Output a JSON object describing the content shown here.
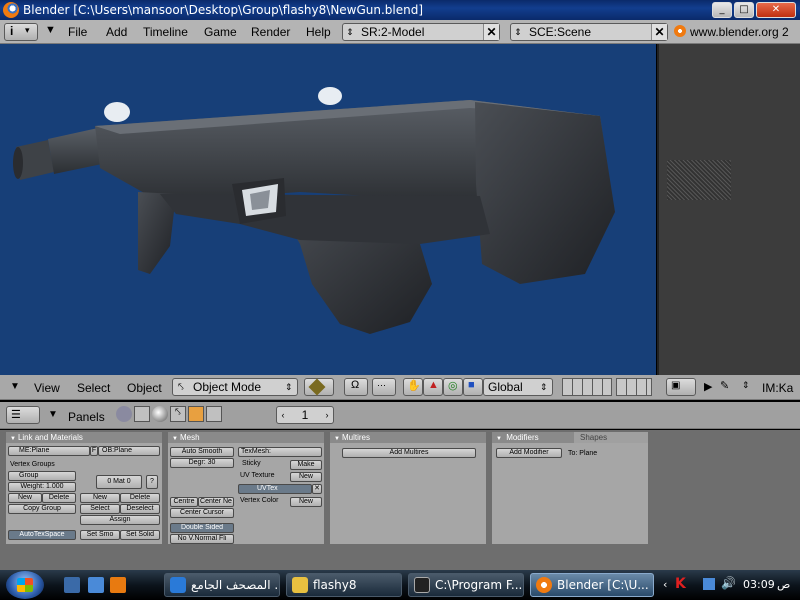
{
  "window": {
    "title": "Blender [C:\\Users\\mansoor\\Desktop\\Group\\flashy8\\NewGun.blend]"
  },
  "menu": {
    "items": [
      "File",
      "Add",
      "Timeline",
      "Game",
      "Render",
      "Help"
    ],
    "screen": "SR:2-Model",
    "scene": "SCE:Scene",
    "website": "www.blender.org 2"
  },
  "view_header": {
    "view": "View",
    "select": "Select",
    "object": "Object",
    "mode": "Object Mode",
    "orientation": "Global",
    "image_menu": "IM:Ka"
  },
  "buttons_header": {
    "panels": "Panels",
    "frame": "1"
  },
  "panels": {
    "link_materials": {
      "title": "Link and Materials",
      "mesh_name": "ME:Plane",
      "f_label": "F",
      "object_name": "OB:Plane",
      "vertex_groups": "Vertex Groups",
      "group": "Group",
      "weight": "Weight: 1.000",
      "new": "New",
      "delete": "Delete",
      "copy_group": "Copy Group",
      "mat_index": "0 Mat 0",
      "question": "?",
      "mat_new": "New",
      "mat_delete": "Delete",
      "select": "Select",
      "deselect": "Deselect",
      "assign": "Assign",
      "autotexspace": "AutoTexSpace",
      "set_smooth": "Set Smo",
      "set_solid": "Set Solid"
    },
    "mesh": {
      "title": "Mesh",
      "auto_smooth": "Auto Smooth",
      "degr": "Degr: 30",
      "texmesh": "TexMesh:",
      "sticky": "Sticky",
      "make": "Make",
      "uv_texture": "UV Texture",
      "uv_new": "New",
      "uvtex": "UVTex",
      "vertex_color": "Vertex Color",
      "vc_new": "New",
      "centre": "Centre",
      "center_new": "Center Ne",
      "center_cursor": "Center Cursor",
      "double_sided": "Double Sided",
      "no_vnormal_flip": "No V.Normal Fli"
    },
    "multires": {
      "title": "Multires",
      "add_multires": "Add Multires"
    },
    "modifiers": {
      "tab_modifiers": "Modifiers",
      "tab_shapes": "Shapes",
      "add_modifier": "Add Modifier",
      "to_plane": "To: Plane"
    }
  },
  "taskbar": {
    "tasks": [
      "المصحف الجامع ...",
      "flashy8",
      "C:\\Program F...",
      "Blender [C:\\U..."
    ],
    "time": "03:09",
    "ampm": "ص"
  }
}
